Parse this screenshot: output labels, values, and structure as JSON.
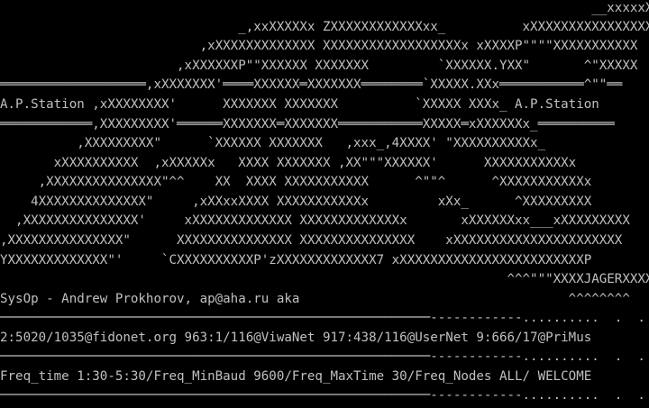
{
  "screen": {
    "foreground": "#c0c0c0",
    "background": "#000000",
    "lines": [
      "                                                                             __xxxxxXXXXXxx._",
      "                               _,xxXXXXXx ZXXXXXXXXXXXXxx_          xXXXXXXXXXXXXXXXXXXXX",
      "                          ,xXXXXXXXXXXXXX XXXXXXXXXXXXXXXXXXx xXXXXP\"\"\"\"XXXXXXXXXXX",
      "                       ,xXXXXXXP\"\"XXXXXX XXXXXXX         `XXXXXX.YXX\"       ^\"XXXXX",
      "═══════════════════,xXXXXXXX'════XXXXXX═XXXXXXX════════`XXXXX.XXx═══════════^\"\"══",
      "A.P.Station ,xXXXXXXXX'      XXXXXXX XXXXXXX          `XXXXX XXXx_ A.P.Station",
      "════════════,XXXXXXXXX'══════XXXXXXX═XXXXXXX═══════════XXXXX═xXXXXXXx_══════════",
      "          ,XXXXXXXXX\"      `XXXXXX XXXXXXX   ,xxx_,4XXXX' \"XXXXXXXXXXx_",
      "       xXXXXXXXXXX  ,xXXXXXx   XXXX XXXXXXX ,XX\"\"\"XXXXXX'      XXXXXXXXXXXx",
      "     ,XXXXXXXXXXXXXXX\"^^    XX  XXXX XXXXXXXXXXX      ^\"\"^      ^XXXXXXXXXXXx",
      "    4XXXXXXXXXXXXXX\"     ,xXXxxXXXX XXXXXXXXXXXx         xXx_      ^XXXXXXXXX",
      "  ,XXXXXXXXXXXXXXX'     xXXXXXXXXXXXXX XXXXXXXXXXXXXx       xXXXXXXxx___xXXXXXXXXX",
      ",XXXXXXXXXXXXXXX\"      XXXXXXXXXXXXXXX XXXXXXXXXXXXXXX    xXXXXXXXXXXXXXXXXXXXXXX",
      "YXXXXXXXXXXXXX\"'     `CXXXXXXXXXXP'zXXXXXXXXXXXXX7 xXXXXXXXXXXXXXXXXXXXXXXXXP",
      "                                                                  ^^^\"\"\"XXXXJAGERXXXXP\"",
      "SysOp - Andrew Prokhorov, ap@aha.ru aka                                   ^^^^^^^^",
      "────────────────────────────────────────────────────────------------..........  .  .  .",
      "2:5020/1035@fidonet.org 963:1/116@ViwaNet 917:438/116@UserNet 9:666/17@PriMus",
      "────────────────────────────────────────────────────────------------..........  .  .  .",
      "Freq_time 1:30-5:30/Freq_MinBaud 9600/Freq_MaxTime 30/Freq_Nodes ALL/ WELCOME",
      "────────────────────────────────────────────────────────------------..........  .  .  ."
    ]
  }
}
